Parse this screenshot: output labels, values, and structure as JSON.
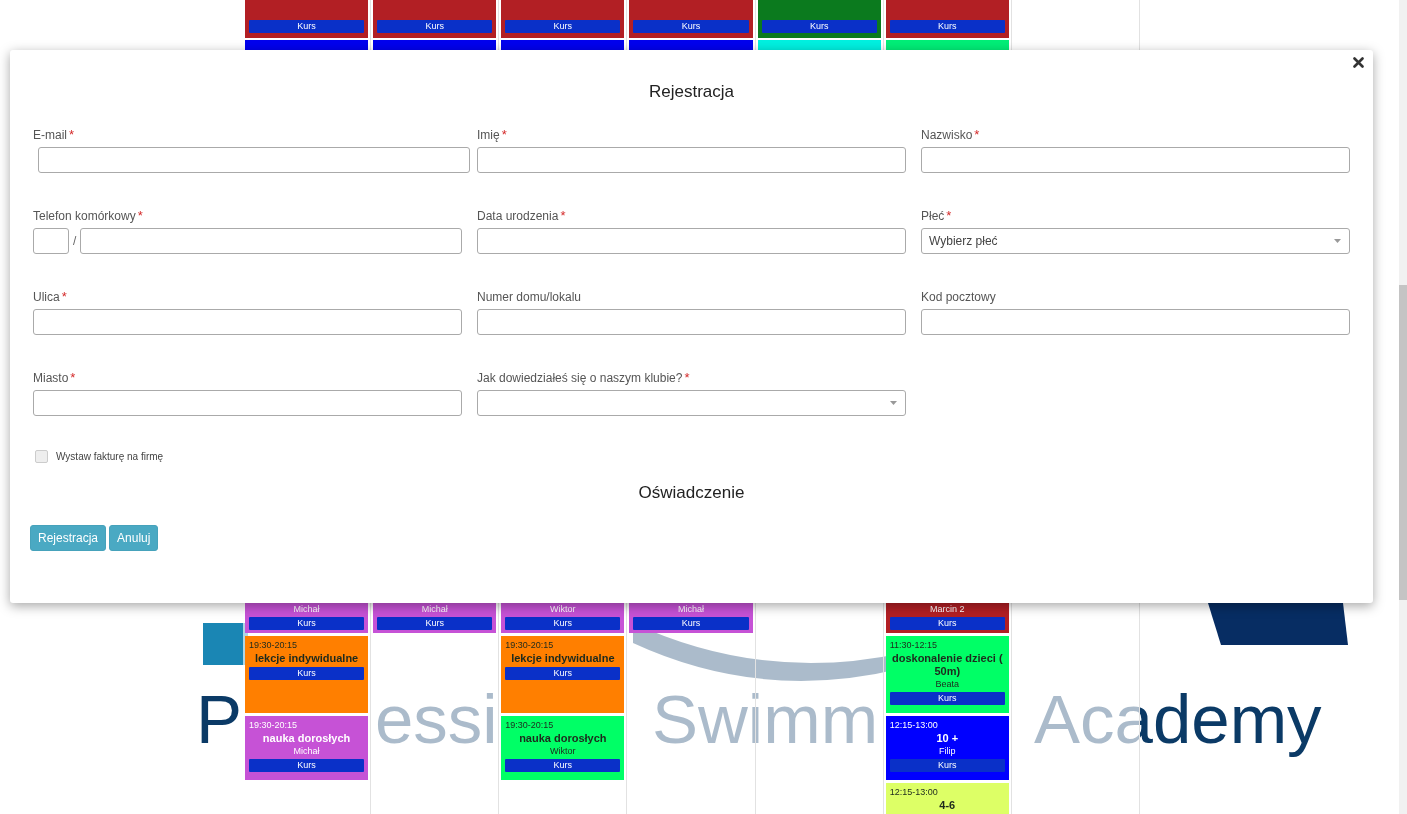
{
  "schedule": {
    "columns": [
      {
        "top": {
          "color": "#b21f24",
          "button": "Kurs"
        },
        "strip": {
          "color": "#0000ee"
        },
        "cards": [
          {
            "color": "#c652d6",
            "teacher": "Michał",
            "button": "Kurs"
          },
          {
            "color": "#ff7f00",
            "time": "19:30-20:15",
            "title": "lekcje indywidualne",
            "button": "Kurs"
          },
          {
            "color": "#c652d6",
            "time": "19:30-20:15",
            "title": "nauka dorosłych",
            "teacher": "Michał",
            "button": "Kurs"
          }
        ]
      },
      {
        "top": {
          "color": "#b21f24",
          "button": "Kurs"
        },
        "strip": {
          "color": "#0000ee"
        },
        "cards": [
          {
            "color": "#c652d6",
            "teacher": "Michał",
            "button": "Kurs"
          }
        ]
      },
      {
        "top": {
          "color": "#b21f24",
          "button": "Kurs"
        },
        "strip": {
          "color": "#0000ee"
        },
        "cards": [
          {
            "color": "#c652d6",
            "teacher": "Wiktor",
            "button": "Kurs"
          },
          {
            "color": "#ff7f00",
            "time": "19:30-20:15",
            "title": "lekcje indywidualne",
            "button": "Kurs"
          },
          {
            "color": "#00ff66",
            "time": "19:30-20:15",
            "title": "nauka dorosłych",
            "teacher": "Wiktor",
            "button": "Kurs"
          }
        ]
      },
      {
        "top": {
          "color": "#b21f24",
          "button": "Kurs"
        },
        "strip": {
          "color": "#0000ee"
        },
        "cards": [
          {
            "color": "#c652d6",
            "teacher": "Michał",
            "button": "Kurs"
          }
        ]
      },
      {
        "top": {
          "color": "#0b7a1e",
          "button": "Kurs"
        },
        "strip": {
          "color": "#00f0e0"
        }
      },
      {
        "top": {
          "color": "#b21f24",
          "button": "Kurs"
        },
        "strip": {
          "color": "#00ee77"
        },
        "cards": [
          {
            "color": "#b21f24",
            "teacher": "Marcin 2",
            "button": "Kurs"
          },
          {
            "color": "#00ff66",
            "time": "11:30-12:15",
            "title": "doskonalenie dzieci ( 50m)",
            "teacher": "Beata",
            "button": "Kurs"
          },
          {
            "color": "#0000ff",
            "time": "12:15-13:00",
            "title": "10 +",
            "teacher": "Filip",
            "button": "Kurs"
          },
          {
            "color": "#ddff66",
            "time": "12:15-13:00",
            "title": "4-6"
          }
        ]
      },
      {}
    ]
  },
  "logo": {
    "parts": [
      "P",
      "essi",
      "Swimm",
      "Academy"
    ]
  },
  "modal": {
    "title": "Rejestracja",
    "required_mark": "*",
    "rows": [
      [
        {
          "kind": "text",
          "label": "E-mail",
          "required": true
        },
        {
          "kind": "text",
          "label": "Imię",
          "required": true
        },
        {
          "kind": "text",
          "label": "Nazwisko",
          "required": true
        }
      ],
      [
        {
          "kind": "phone",
          "label": "Telefon komórkowy",
          "required": true,
          "separator": "/"
        },
        {
          "kind": "text",
          "label": "Data urodzenia",
          "required": true
        },
        {
          "kind": "select",
          "label": "Płeć",
          "required": true,
          "placeholder": "Wybierz płeć"
        }
      ],
      [
        {
          "kind": "text",
          "label": "Ulica",
          "required": true
        },
        {
          "kind": "text",
          "label": "Numer domu/lokalu",
          "required": false
        },
        {
          "kind": "text",
          "label": "Kod pocztowy",
          "required": false
        }
      ],
      [
        {
          "kind": "text",
          "label": "Miasto",
          "required": true
        },
        {
          "kind": "select",
          "label": "Jak dowiedziałeś się o naszym klubie?",
          "required": true
        }
      ]
    ],
    "invoice": {
      "label": "Wystaw fakturę na firmę",
      "checked": false
    },
    "section": "Oświadczenie",
    "buttons": [
      "Rejestracja",
      "Anuluj"
    ]
  }
}
